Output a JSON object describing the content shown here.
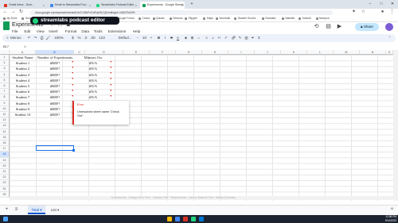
{
  "browser": {
    "tabs": [
      {
        "label": "Gmail Inbox - Dom...",
        "color": "#d93025"
      },
      {
        "label": "Email to Streamlabs Pod...",
        "color": "#4285f4"
      },
      {
        "label": "Streamlabs Podcast Editor",
        "color": "#21d37f"
      },
      {
        "label": "Experiments - Google Sheets",
        "color": "#0f9d58"
      }
    ],
    "url": "docs.google.com/spreadsheets/d/1e2YJ8hPxGdFqN3LSjZ/edit#gid=1683754299",
    "bookmarks": [
      "My Drive",
      "Google Classroom",
      "Kami",
      "Gmail",
      "YouTube",
      "Edpuzzle",
      "Google Forms",
      "Canva",
      "Quizizz",
      "Desmos",
      "Flipgrid",
      "Maps",
      "Wordwall",
      "Student Scores",
      "Edulastic",
      "Wakelet",
      "Kahoot!",
      "Nearpod"
    ]
  },
  "banner": {
    "text": "streamlabs podcast editor"
  },
  "doc": {
    "title": "Experiments",
    "menu": [
      "File",
      "Edit",
      "View",
      "Insert",
      "Format",
      "Data",
      "Tools",
      "Extensions",
      "Help"
    ],
    "share_label": "Share"
  },
  "toolbar": {
    "search_label": "Menus",
    "zoom": "100%",
    "currency": "$",
    "percent": "%",
    "format": ".0",
    "format2": ".00",
    "number_format": "123",
    "font": "Defaul...",
    "font_size": "10",
    "bold": "B",
    "italic": "I",
    "strike": "S",
    "text_color": "A"
  },
  "formula_bar": {
    "cell_ref": "B17",
    "fx": "fx"
  },
  "columns": [
    "A",
    "B",
    "C",
    "D",
    "E",
    "F",
    "G",
    "H",
    "I",
    "J",
    "K",
    "L",
    "M",
    "N",
    "O"
  ],
  "selected_column": "B",
  "selected_row": "18",
  "rows": [
    {
      "num": "1",
      "a": "Student Name",
      "b": "Number of Experiments",
      "d": "Minutes Ow"
    },
    {
      "num": "2",
      "a": "Student 1",
      "b": "#REF!",
      "d": "#N/A"
    },
    {
      "num": "3",
      "a": "Student 2",
      "b": "#REF!",
      "d": "#N/A"
    },
    {
      "num": "4",
      "a": "Student 3",
      "b": "#REF!",
      "d": "#N/A"
    },
    {
      "num": "5",
      "a": "Student 4",
      "b": "#REF!",
      "d": "#N/A"
    },
    {
      "num": "6",
      "a": "Student 5",
      "b": "#REF!",
      "d": "#N/A"
    },
    {
      "num": "7",
      "a": "Student 6",
      "b": "#REF!",
      "d": "#N/A"
    },
    {
      "num": "8",
      "a": "Student 7",
      "b": "#REF!",
      "d": "#N/A"
    },
    {
      "num": "9",
      "a": "Student 8",
      "b": "#REF!",
      "d": ""
    },
    {
      "num": "10",
      "a": "Student 9",
      "b": "#REF!",
      "d": ""
    },
    {
      "num": "11",
      "a": "Student 10",
      "b": "#REF!",
      "d": ""
    },
    {
      "num": "12",
      "a": "",
      "b": "",
      "d": ""
    },
    {
      "num": "13",
      "a": "",
      "b": "",
      "d": ""
    },
    {
      "num": "14",
      "a": "",
      "b": "",
      "d": ""
    },
    {
      "num": "15",
      "a": "",
      "b": "",
      "d": ""
    },
    {
      "num": "16",
      "a": "",
      "b": "",
      "d": ""
    },
    {
      "num": "17",
      "a": "",
      "b": "",
      "d": ""
    },
    {
      "num": "18",
      "a": "",
      "b": "",
      "d": ""
    },
    {
      "num": "19",
      "a": "",
      "b": "",
      "d": ""
    },
    {
      "num": "20",
      "a": "",
      "b": "",
      "d": ""
    },
    {
      "num": "21",
      "a": "",
      "b": "",
      "d": ""
    },
    {
      "num": "22",
      "a": "",
      "b": "",
      "d": ""
    },
    {
      "num": "23",
      "a": "",
      "b": "",
      "d": ""
    },
    {
      "num": "24",
      "a": "",
      "b": "",
      "d": ""
    },
    {
      "num": "25",
      "a": "",
      "b": "",
      "d": ""
    }
  ],
  "error_tooltip": {
    "title": "Error",
    "body": "Unresolved sheet name 'Check Out'."
  },
  "ghost_text": "Experiments  ·  Change Over Time  ·  Calories Trial  ·  Temperatures  ·  Carbon Balance Trial  ·  Weight Summary",
  "sheets": {
    "add": "+",
    "menu": "≡",
    "tabs": [
      "Total",
      "List"
    ],
    "active": "Total"
  },
  "taskbar": {
    "time": "12:58 PM",
    "date": "9/14/2023"
  }
}
